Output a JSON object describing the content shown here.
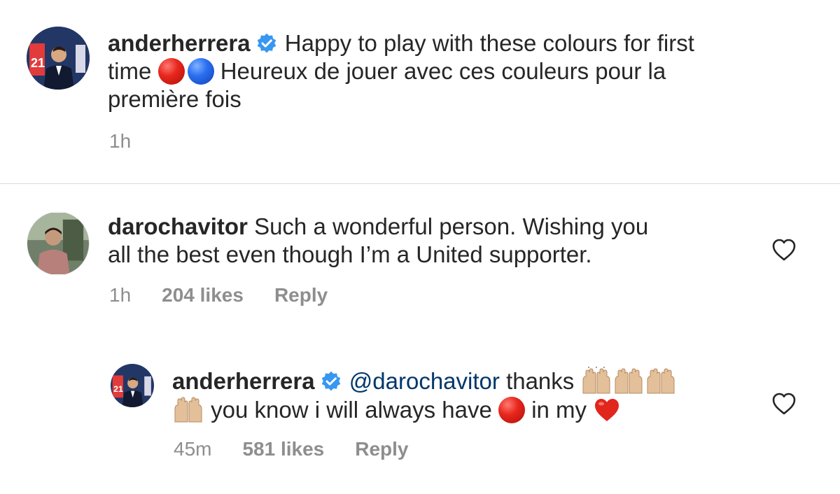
{
  "caption": {
    "username": "anderherrera",
    "text_line1": "Happy to play with these colours for first",
    "text_line2_a": "time",
    "text_line2_b": "Heureux de jouer avec ces couleurs pour la",
    "text_line3": "première fois",
    "time": "1h"
  },
  "comments": [
    {
      "username": "darochavitor",
      "text_line1": "Such a wonderful person. Wishing you",
      "text_line2": "all the best even though I’m a United supporter.",
      "time": "1h",
      "likes": "204 likes",
      "reply_label": "Reply"
    },
    {
      "username": "anderherrera",
      "mention": "@darochavitor",
      "text_after_mention": "thanks",
      "text_line2_a": "you know i will always have",
      "text_line2_b": "in my",
      "time": "45m",
      "likes": "581 likes",
      "reply_label": "Reply"
    }
  ],
  "icons": {
    "verified": "verified-badge-icon",
    "like": "heart-outline-icon",
    "raising_hands": "raising-hands-emoji",
    "red_circle": "red-circle-emoji",
    "blue_circle": "blue-circle-emoji",
    "heart": "red-heart-emoji"
  },
  "colors": {
    "verified_blue": "#3897f0",
    "mention": "#00376b",
    "meta_gray": "#8e8e8e"
  }
}
